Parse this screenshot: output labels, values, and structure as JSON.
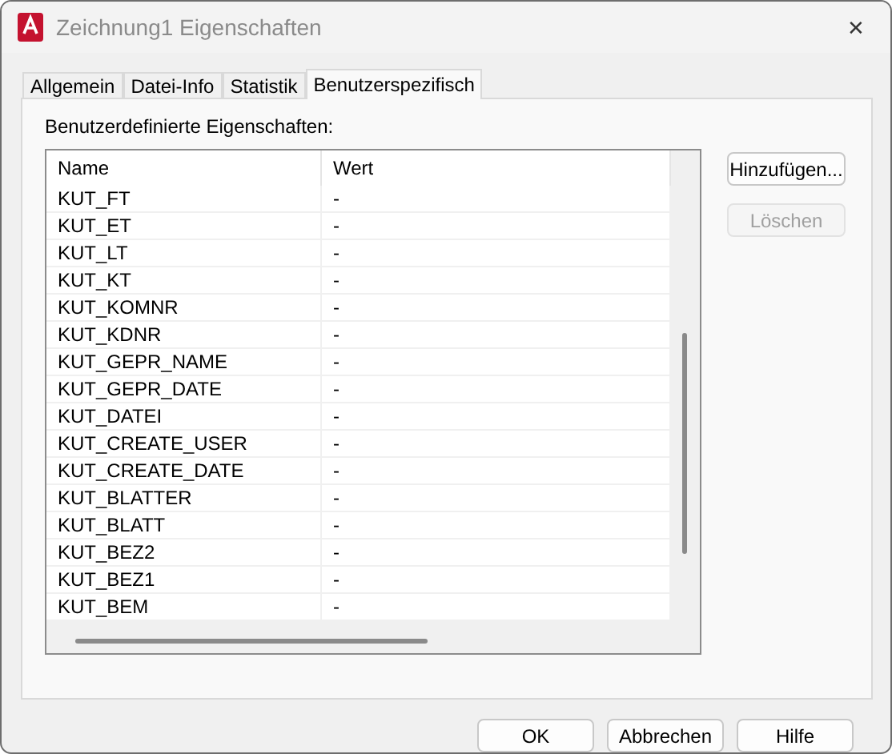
{
  "window": {
    "title": "Zeichnung1 Eigenschaften",
    "close": "✕"
  },
  "tabs": [
    {
      "label": "Allgemein",
      "selected": false
    },
    {
      "label": "Datei-Info",
      "selected": false
    },
    {
      "label": "Statistik",
      "selected": false
    },
    {
      "label": "Benutzerspezifisch",
      "selected": true
    }
  ],
  "section_label": "Benutzerdefinierte Eigenschaften:",
  "table": {
    "columns": [
      "Name",
      "Wert"
    ],
    "rows": [
      [
        "KUT_FT",
        "-"
      ],
      [
        "KUT_ET",
        "-"
      ],
      [
        "KUT_LT",
        "-"
      ],
      [
        "KUT_KT",
        "-"
      ],
      [
        "KUT_KOMNR",
        "-"
      ],
      [
        "KUT_KDNR",
        "-"
      ],
      [
        "KUT_GEPR_NAME",
        "-"
      ],
      [
        "KUT_GEPR_DATE",
        "-"
      ],
      [
        "KUT_DATEI",
        "-"
      ],
      [
        "KUT_CREATE_USER",
        "-"
      ],
      [
        "KUT_CREATE_DATE",
        "-"
      ],
      [
        "KUT_BLATTER",
        "-"
      ],
      [
        "KUT_BLATT",
        "-"
      ],
      [
        "KUT_BEZ2",
        "-"
      ],
      [
        "KUT_BEZ1",
        "-"
      ],
      [
        "KUT_BEM",
        "-"
      ]
    ]
  },
  "side_buttons": [
    {
      "label": "Hinzufügen...",
      "disabled": false
    },
    {
      "label": "Löschen",
      "disabled": true
    }
  ],
  "buttons": [
    {
      "label": "OK"
    },
    {
      "label": "Abbrechen"
    },
    {
      "label": "Hilfe"
    }
  ]
}
